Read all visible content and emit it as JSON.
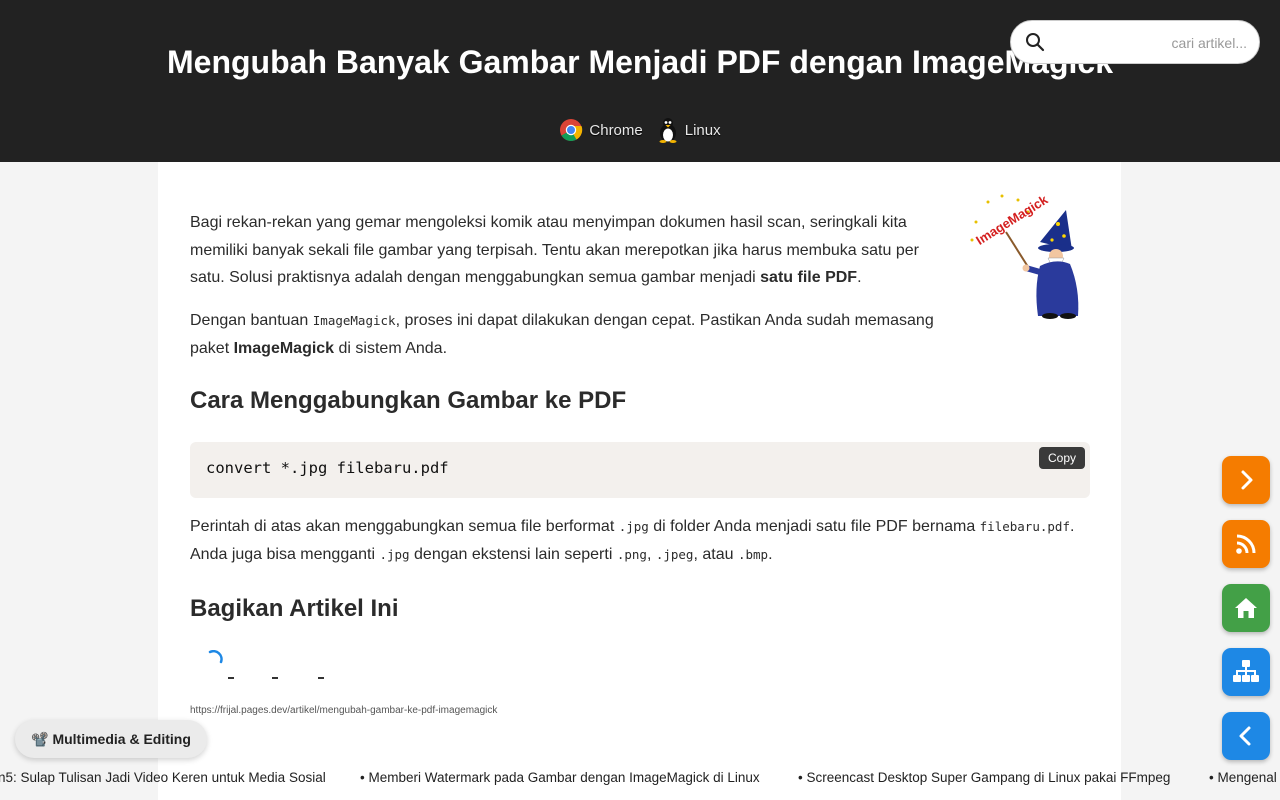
{
  "page": {
    "title": "Mengubah Banyak Gambar Menjadi PDF dengan ImageMagick",
    "tags": [
      {
        "label": "Chrome",
        "icon": "chrome-icon"
      },
      {
        "label": "Linux",
        "icon": "linux-tux-icon"
      }
    ]
  },
  "search": {
    "placeholder": "cari artikel...",
    "value": "",
    "icon": "search-icon"
  },
  "logo": {
    "text": "ImageMagick",
    "icon": "imagemagick-wizard-logo"
  },
  "article": {
    "p1_text": "Bagi rekan-rekan yang gemar mengoleksi komik atau menyimpan dokumen hasil scan, seringkali kita memiliki banyak sekali file gambar yang terpisah. Tentu akan merepotkan jika harus membuka satu per satu. Solusi praktisnya adalah dengan menggabungkan semua gambar menjadi ",
    "p1_bold": "satu file PDF",
    "p1_end": ".",
    "p2_start": "Dengan bantuan ",
    "p2_code": "ImageMagick",
    "p2_mid": ", proses ini dapat dilakukan dengan cepat. Pastikan Anda sudah memasang paket ",
    "p2_bold": "ImageMagick",
    "p2_end": " di sistem Anda.",
    "h2_convert": "Cara Menggabungkan Gambar ke PDF",
    "code": "convert *.jpg filebaru.pdf",
    "copy_label": "Copy",
    "p3": [
      "Perintah di atas akan menggabungkan semua file berformat ",
      ".jpg",
      " di folder Anda menjadi satu file PDF bernama ",
      "filebaru.pdf",
      ". Anda juga bisa mengganti ",
      ".jpg",
      " dengan ekstensi lain seperti ",
      ".png",
      ", ",
      ".jpeg",
      ", atau ",
      ".bmp",
      "."
    ],
    "h2_share": "Bagikan Artikel Ini",
    "share_url": "https://frijal.pages.dev/artikel/mengubah-gambar-ke-pdf-imagemagick"
  },
  "side_nav": [
    {
      "name": "next-button",
      "icon": "chevron-right-icon",
      "color": "#f57c00"
    },
    {
      "name": "rss-button",
      "icon": "rss-icon",
      "color": "#f57c00"
    },
    {
      "name": "home-button",
      "icon": "home-icon",
      "color": "#43a047"
    },
    {
      "name": "sitemap-button",
      "icon": "sitemap-icon",
      "color": "#1e88e5"
    },
    {
      "name": "prev-button",
      "icon": "chevron-left-icon",
      "color": "#1e88e5"
    }
  ],
  "category": {
    "emoji": "📽️",
    "label": "Multimedia & Editing"
  },
  "ticker": [
    "n5: Sulap Tulisan Jadi Video Keren untuk Media Sosial",
    "• Memberi Watermark pada Gambar dengan ImageMagick di Linux",
    "• Screencast Desktop Super Gampang di Linux pakai FFmpeg",
    "• Mengenal"
  ],
  "colors": {
    "header_bg": "#222222",
    "orange": "#f57c00",
    "green": "#43a047",
    "blue": "#1e88e5",
    "code_bg": "#f3f0ed"
  }
}
